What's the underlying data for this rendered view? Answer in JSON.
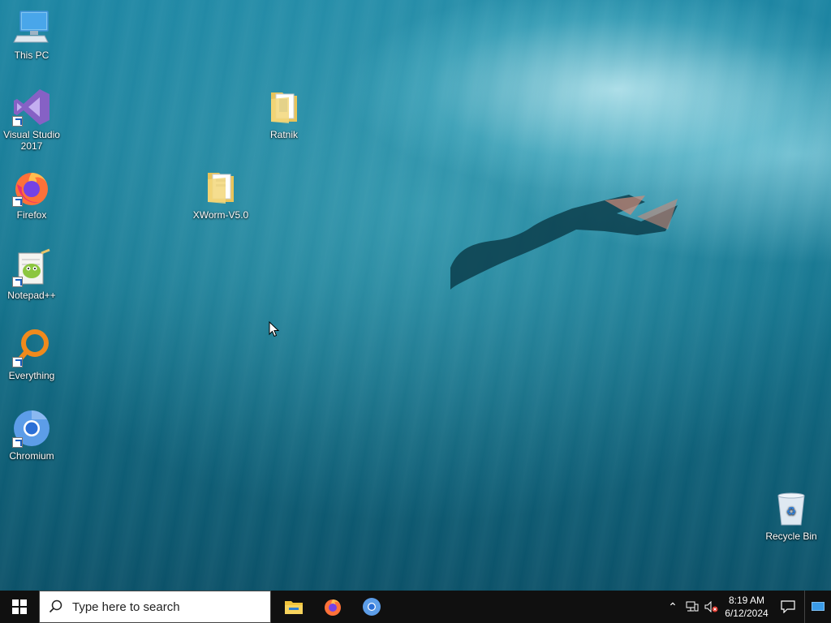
{
  "desktop": {
    "icons": [
      {
        "label": "This PC",
        "icon": "computer-icon"
      },
      {
        "label": "Visual Studio 2017",
        "icon": "visual-studio-icon"
      },
      {
        "label": "Firefox",
        "icon": "firefox-icon"
      },
      {
        "label": "Notepad++",
        "icon": "notepad-plus-plus-icon"
      },
      {
        "label": "Everything",
        "icon": "everything-search-icon"
      },
      {
        "label": "Chromium",
        "icon": "chromium-icon"
      },
      {
        "label": "Ratnik",
        "icon": "folder-icon"
      },
      {
        "label": "XWorm-V5.0",
        "icon": "folder-icon"
      },
      {
        "label": "Recycle Bin",
        "icon": "recycle-bin-icon"
      }
    ]
  },
  "taskbar": {
    "search_placeholder": "Type here to search",
    "pinned": [
      {
        "name": "File Explorer",
        "icon": "file-explorer-icon"
      },
      {
        "name": "Firefox",
        "icon": "firefox-icon"
      },
      {
        "name": "Chromium",
        "icon": "chromium-icon"
      }
    ],
    "tray": {
      "time": "8:19 AM",
      "date": "6/12/2024"
    }
  },
  "colors": {
    "taskbar_bg": "#101010",
    "accent": "#76b9ed"
  }
}
